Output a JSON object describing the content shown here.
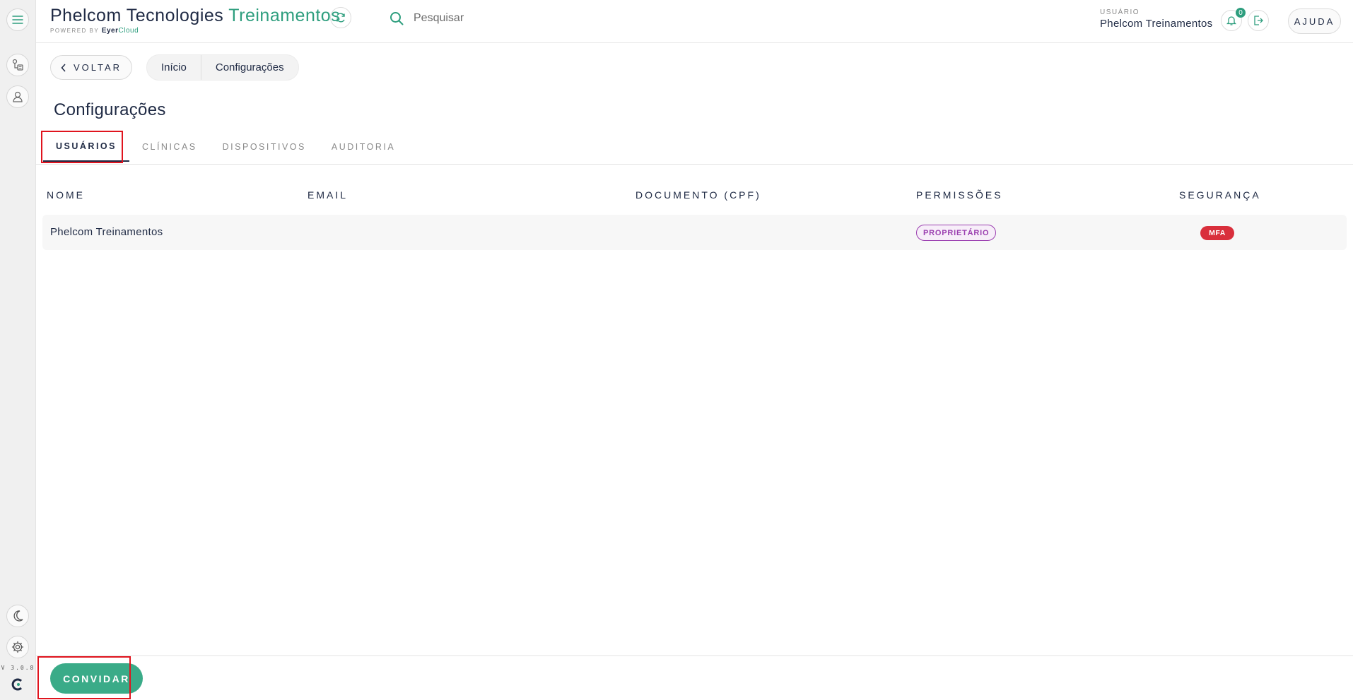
{
  "app": {
    "title_main": "Phelcom Tecnologies",
    "title_accent": "Treinamentos",
    "powered_by": "POWERED BY",
    "powered_brand": "Eyer",
    "powered_brand_accent": "Cloud",
    "version": "V 3.0.8"
  },
  "search": {
    "placeholder": "Pesquisar"
  },
  "user": {
    "caption": "USUÁRIO",
    "name": "Phelcom Treinamentos",
    "notifications": "0"
  },
  "help": {
    "label": "AJUDA"
  },
  "nav": {
    "back_label": "VOLTAR",
    "breadcrumb": [
      "Início",
      "Configurações"
    ]
  },
  "page": {
    "title": "Configurações"
  },
  "tabs": [
    {
      "label": "USUÁRIOS",
      "active": true
    },
    {
      "label": "CLÍNICAS",
      "active": false
    },
    {
      "label": "DISPOSITIVOS",
      "active": false
    },
    {
      "label": "AUDITORIA",
      "active": false
    }
  ],
  "table": {
    "headers": [
      "NOME",
      "EMAIL",
      "DOCUMENTO (CPF)",
      "PERMISSÕES",
      "SEGURANÇA"
    ],
    "rows": [
      {
        "name": "Phelcom Treinamentos",
        "email": "",
        "document": "",
        "permission": "PROPRIETÁRIO",
        "security": "MFA"
      }
    ]
  },
  "footer": {
    "invite_label": "CONVIDAR"
  },
  "colors": {
    "accent": "#2e9e7e",
    "primary_text": "#1f2a44",
    "permission_badge": "#9b3fb0",
    "security_badge": "#d92f3c",
    "highlight": "#e0141e"
  },
  "icons": [
    "menu-icon",
    "exams-icon",
    "patients-icon",
    "dark-mode-icon",
    "settings-icon",
    "sync-icon",
    "search-icon",
    "bell-icon",
    "logout-icon",
    "chevron-left-icon"
  ]
}
